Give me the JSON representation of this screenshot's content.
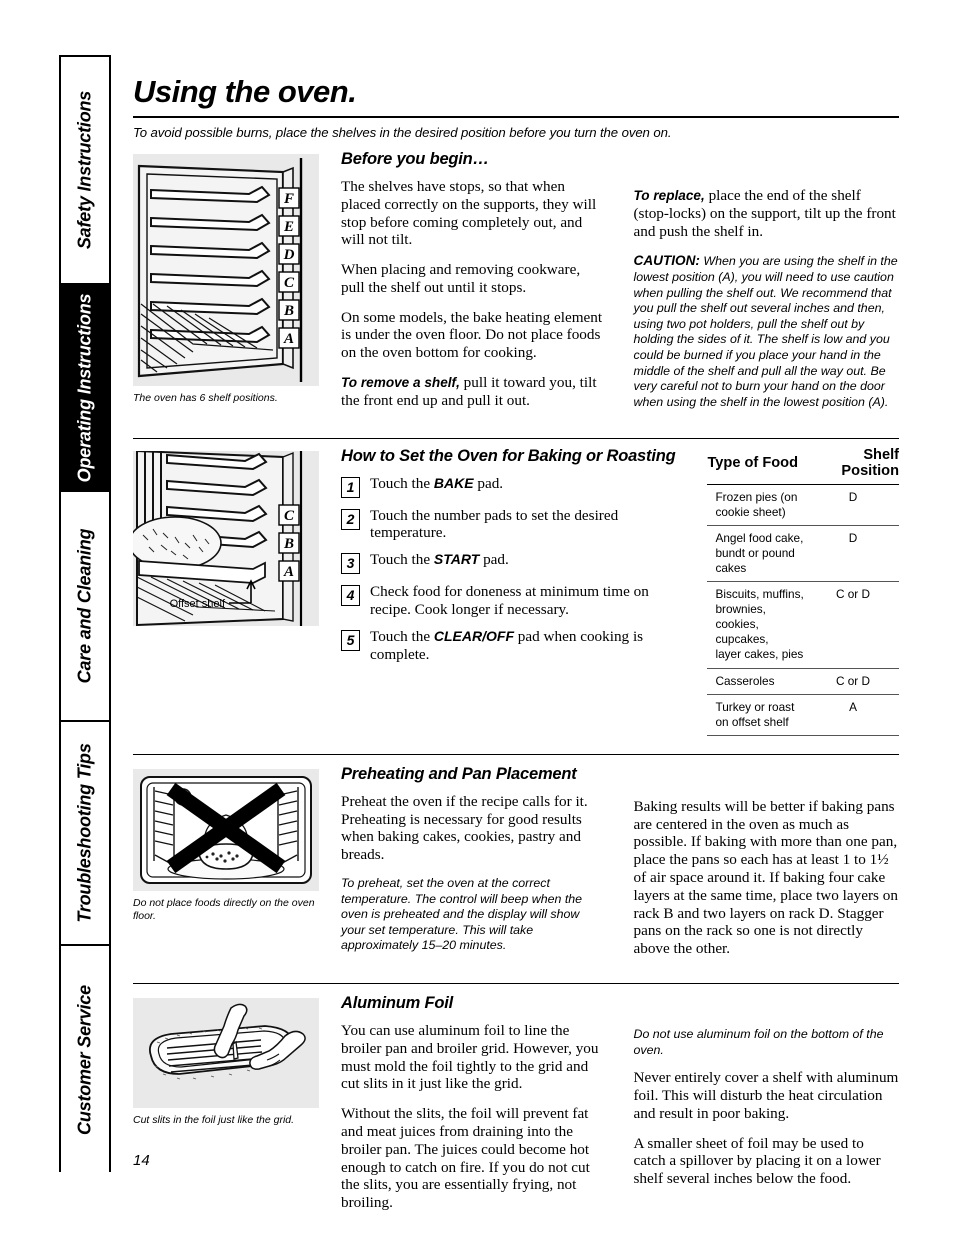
{
  "page": {
    "number": "14",
    "title": "Using the oven.",
    "intro": "To avoid possible burns, place the shelves in the desired position before you turn the oven on."
  },
  "sidebar": {
    "tabs": [
      {
        "label": "Safety Instructions",
        "active": false
      },
      {
        "label": "Operating Instructions",
        "active": true
      },
      {
        "label": "Care and Cleaning",
        "active": false
      },
      {
        "label": "Troubleshooting Tips",
        "active": false
      },
      {
        "label": "Customer Service",
        "active": false
      }
    ]
  },
  "sections": {
    "before": {
      "heading": "Before you begin…",
      "figure_caption": "The oven has 6 shelf positions.",
      "shelf_letters": [
        "F",
        "E",
        "D",
        "C",
        "B",
        "A"
      ],
      "p1": "The shelves have stops, so that when placed correctly on the supports, they will stop before coming completely out, and will not tilt.",
      "p2": "When placing and removing cookware, pull the shelf out until it stops.",
      "p3": "On some models, the bake heating element is under the oven floor. Do not place foods on the oven bottom for cooking.",
      "remove_lead": "To remove a shelf,",
      "remove_text": " pull it toward you, tilt the front end up and pull it out.",
      "replace_lead": "To replace,",
      "replace_text": " place the end of the shelf (stop-locks) on the support, tilt up the front and push the shelf in.",
      "caution_lead": "CAUTION:",
      "caution_text": " When you are using the shelf in the lowest position (A), you will need to use caution when pulling the shelf out. We recommend that you pull the shelf out several inches and then, using two pot holders, pull the shelf out by holding the sides of it. The shelf is low and you could be burned if you place your hand in the middle of the shelf and pull all the way out. Be very careful not to burn your hand on the door when using the shelf in the lowest position (A)."
    },
    "baking": {
      "heading": "How to Set the Oven for Baking or Roasting",
      "figure_label": "Offset shelf",
      "shelf_letters": [
        "C",
        "B",
        "A"
      ],
      "steps": [
        {
          "num": "1",
          "pre": "Touch the ",
          "pad": "BAKE",
          "post": " pad."
        },
        {
          "num": "2",
          "pre": "Touch the number pads to set the desired temperature.",
          "pad": "",
          "post": ""
        },
        {
          "num": "3",
          "pre": "Touch the ",
          "pad": "START",
          "post": " pad."
        },
        {
          "num": "4",
          "pre": "Check food for doneness at minimum time on recipe. Cook longer if necessary.",
          "pad": "",
          "post": ""
        },
        {
          "num": "5",
          "pre": "Touch the ",
          "pad": "CLEAR/OFF",
          "post": " pad when cooking is complete."
        }
      ],
      "table": {
        "columns": [
          "Type of Food",
          "Shelf Position"
        ],
        "rows": [
          {
            "food": "Frozen pies (on cookie sheet)",
            "position": "D"
          },
          {
            "food": "Angel food cake,\nbundt or pound cakes",
            "position": "D"
          },
          {
            "food": "Biscuits, muffins, brownies,\ncookies, cupcakes,\nlayer cakes, pies",
            "position": "C or D"
          },
          {
            "food": "Casseroles",
            "position": "C or D"
          },
          {
            "food": "Turkey or roast on offset shelf",
            "position": "A"
          }
        ]
      }
    },
    "preheating": {
      "heading": "Preheating and Pan Placement",
      "figure_caption": "Do not place foods directly on the oven floor.",
      "p1": "Preheat the oven if the recipe calls for it. Preheating is necessary for good results when baking cakes, cookies, pastry and breads.",
      "p2_italic": "To preheat, set the oven at the correct temperature. The control will beep when the oven is preheated and the display will show your set temperature. This will take approximately 15–20 minutes.",
      "right": "Baking results will be better if baking pans are centered in the oven as much as possible. If baking with more than one pan, place the pans so each has at least 1 to 1½  of air space around it. If baking four cake layers at the same time, place two layers on rack B and two layers on rack D. Stagger pans on the rack so one is not directly above the other."
    },
    "foil": {
      "heading": "Aluminum Foil",
      "figure_caption": "Cut slits in the foil just like the grid.",
      "p1": "You can use aluminum foil to line the broiler pan and broiler grid. However, you must mold the foil tightly to the grid and cut slits in it just like the grid.",
      "p2": "Without the slits, the foil will prevent fat and meat juices from draining into the broiler pan. The juices could become hot enough to catch on fire. If you do not cut the slits, you are essentially frying, not broiling.",
      "r1_italic": "Do not use aluminum foil on the bottom of the oven.",
      "r2": "Never entirely cover a shelf with aluminum foil. This will disturb the heat circulation and result in poor baking.",
      "r3": "A smaller sheet of foil may be used to catch a spillover by placing it on a lower shelf several inches below the food."
    }
  },
  "colors": {
    "ink": "#000000",
    "figure_bg": "#e9e9e9",
    "active_tab_bg": "#000000",
    "active_tab_fg": "#ffffff"
  }
}
